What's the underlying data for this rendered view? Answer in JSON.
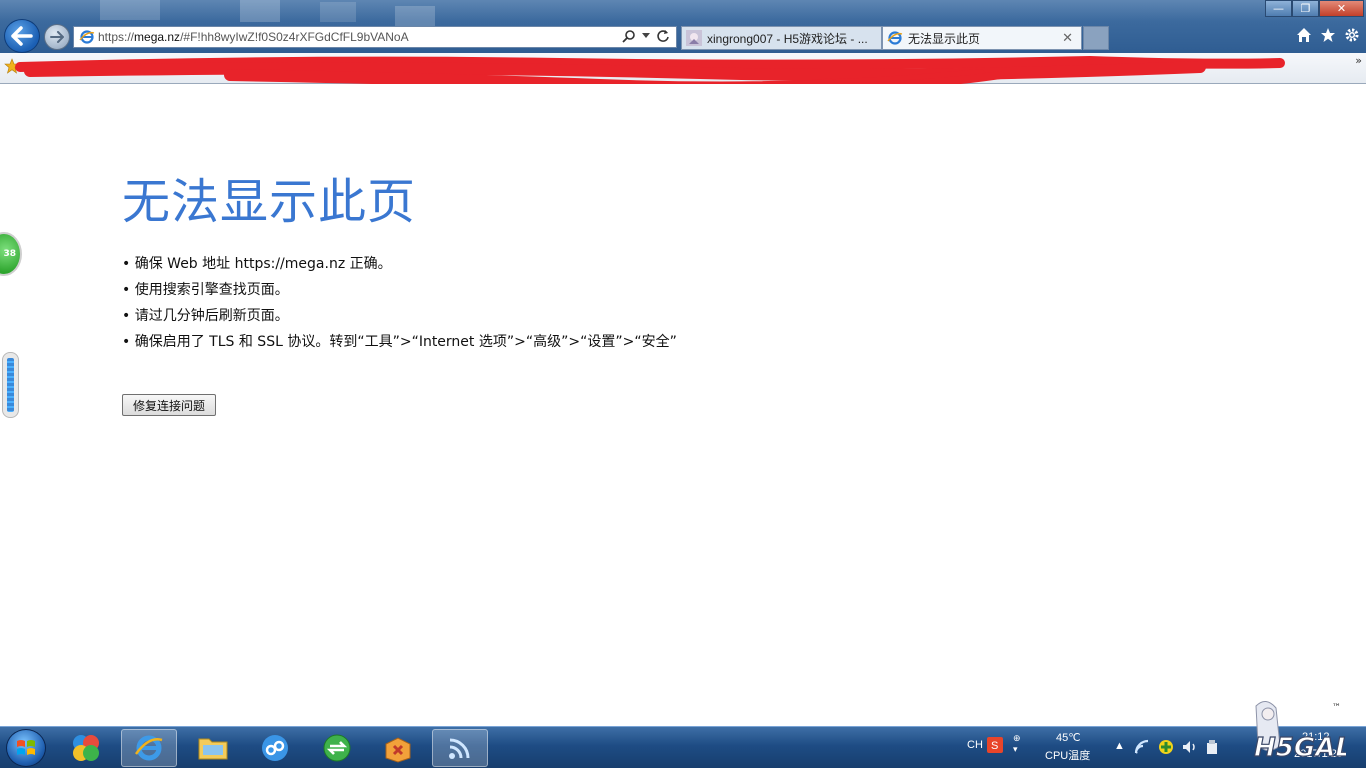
{
  "browser": {
    "address_url_prefix": "https://",
    "address_url_host": "mega.nz",
    "address_url_rest": "/#F!hh8wyIwZ!f0S0z4rXFGdCfFL9bVANoA",
    "tabs": [
      {
        "label": "xingrong007 - H5游戏论坛 - ..."
      },
      {
        "label": "无法显示此页"
      }
    ]
  },
  "error_page": {
    "title": "无法显示此页",
    "tips": [
      "确保 Web 地址 https://mega.nz 正确。",
      "使用搜索引擎查找页面。",
      "请过几分钟后刷新页面。",
      "确保启用了 TLS 和 SSL 协议。转到“工具”>“Internet 选项”>“高级”>“设置”>“安全”"
    ],
    "fix_button": "修复连接问题"
  },
  "side_widget": {
    "badge": "38"
  },
  "taskbar": {
    "ime": "CH",
    "temperature": "45℃",
    "cpu_label": "CPU温度",
    "time": "21:12",
    "date": "2017/1/29"
  },
  "colors": {
    "title_blue": "#3a77d1",
    "redaction": "#e8232a"
  }
}
